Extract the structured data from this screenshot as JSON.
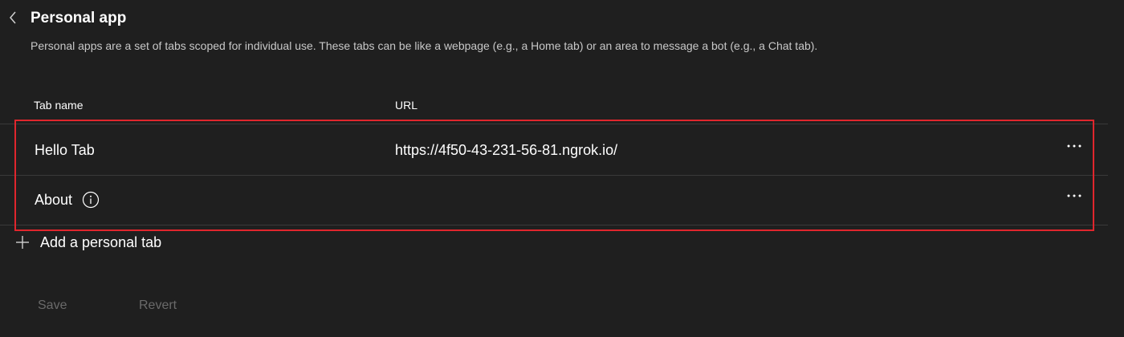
{
  "header": {
    "back_icon": "chevron-left-icon",
    "title": "Personal app",
    "description": "Personal apps are a set of tabs scoped for individual use. These tabs can be like a webpage (e.g., a Home tab) or an area to message a bot (e.g., a Chat tab)."
  },
  "table": {
    "columns": [
      "Tab name",
      "URL"
    ],
    "rows": [
      {
        "name": "Hello Tab",
        "url": "https://4f50-43-231-56-81.ngrok.io/",
        "more_icon": "more-horizontal-icon"
      },
      {
        "name": "About",
        "url": "",
        "info_icon": "info-icon",
        "more_icon": "more-horizontal-icon"
      }
    ]
  },
  "add_tab": {
    "icon": "plus-icon",
    "label": "Add a personal tab"
  },
  "footer": {
    "save_label": "Save",
    "revert_label": "Revert"
  },
  "colors": {
    "background": "#1f1f1f",
    "highlight_border": "#e0262d",
    "disabled_text": "#6a6a6a",
    "muted_text": "#c8c8c8"
  }
}
